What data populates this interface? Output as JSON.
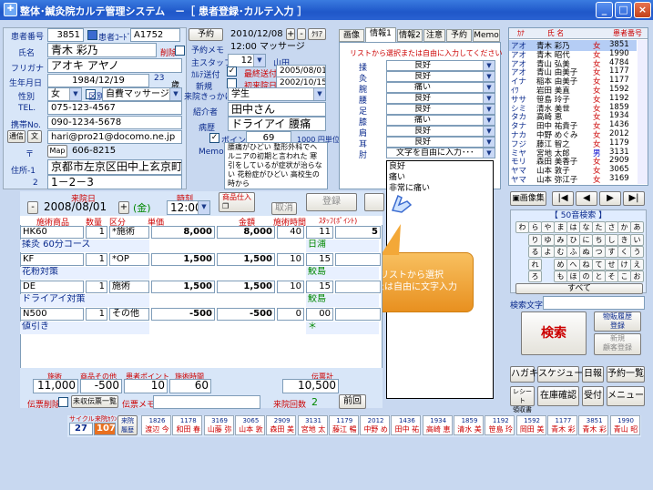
{
  "window": {
    "title": "整体･鍼灸院カルテ管理システム　－［ 患者登録･カルテ入力 ］"
  },
  "patient": {
    "id_label": "患者番号",
    "id": "3851",
    "code_label": "患者ｺｰﾄﾞ",
    "code": "A1752",
    "delete_label": "削除",
    "name_label": "氏名",
    "name": "青木 彩乃",
    "kana_label": "フリガナ",
    "kana": "アオキ アヤノ",
    "birth_label": "生年月日",
    "birth": "1984/12/19",
    "age": "23",
    "age_unit": "歳",
    "sex_label": "性別",
    "sex": "女",
    "kubun_label": "区別",
    "kubun": "自費マッサージ",
    "tel_label": "TEL.",
    "tel": "075-123-4567",
    "mobile_label": "携帯No.",
    "mobile": "090-1234-5678",
    "mail_btn": "通信",
    "mail_btn2": "文",
    "email": "hari@pro21@docomo.ne.jp",
    "zip_label": "〒",
    "map_btn": "Map",
    "zip": "606-8215",
    "addr1_label": "住所-1",
    "addr1": "京都市左京区田中上玄京町",
    "addr2_label": "2",
    "addr2": "1－2－3"
  },
  "reserve": {
    "btn": "予約",
    "date": "2010/12/08",
    "plus": "+",
    "minus": "-",
    "clear": "ｸﾘｱ",
    "memo_label": "予約メモ",
    "memo": "12:00 マッサージ",
    "staff_label": "主スタッフ",
    "staff_no": "12",
    "staff": "山田",
    "visit_label": "ｶﾙﾃ送付",
    "last_label": "最終送付",
    "last_date": "2005/08/01",
    "new_label": "新規",
    "first_label": "初来院日",
    "first_date": "2002/10/15",
    "trigger_label": "来院きっかけ",
    "trigger": "学生",
    "intro_label": "紹介者",
    "intro": "田中さん",
    "disease_label": "病歴",
    "disease": "ドライアイ 腰痛",
    "point_label": "ポイント",
    "points": "69",
    "unit_price": "1000 円単位",
    "memo2_label": "Memo",
    "memo2": "腰痛がひどい 整形外科でヘルニアの初期と言われた 寒引をしているが症状が治らない 花粉症がひどい 高校生の時から"
  },
  "tabs": [
    {
      "label": "画像",
      "active": false
    },
    {
      "label": "情報1",
      "active": true
    },
    {
      "label": "情報2",
      "active": false
    },
    {
      "label": "注意",
      "active": false
    },
    {
      "label": "予約",
      "active": false
    },
    {
      "label": "Memo",
      "active": false
    }
  ],
  "info1": {
    "hint": "リストから選択または自由に入力してください",
    "rows": [
      {
        "label": "揉",
        "value": "良好"
      },
      {
        "label": "灸",
        "value": "良好"
      },
      {
        "label": "腕",
        "value": "痛い"
      },
      {
        "label": "腰",
        "value": "良好"
      },
      {
        "label": "足",
        "value": "良好"
      },
      {
        "label": "膝",
        "value": "痛い"
      },
      {
        "label": "肩",
        "value": "良好"
      },
      {
        "label": "耳",
        "value": "良好"
      },
      {
        "label": "肘",
        "value": "文字を自由に入力･･･"
      }
    ],
    "dropdown_options": [
      "良好",
      "痛い",
      "非常に痛い"
    ]
  },
  "callout": {
    "text": "リストから選択\nまたは自由に文字入力"
  },
  "patient_list": {
    "headers": [
      "ｶﾅ",
      "氏 名",
      "",
      "患者番号"
    ],
    "rows": [
      {
        "kana": "アオ",
        "name": "青木 彩乃",
        "sex": "女",
        "no": "3851"
      },
      {
        "kana": "アオ",
        "name": "青木 昭代",
        "sex": "女",
        "no": "1990"
      },
      {
        "kana": "アオ",
        "name": "青山 弘美",
        "sex": "女",
        "no": "4784"
      },
      {
        "kana": "アオ",
        "name": "青山 由美子",
        "sex": "女",
        "no": "1177"
      },
      {
        "kana": "イナ",
        "name": "稲本 由美子",
        "sex": "女",
        "no": "1177"
      },
      {
        "kana": "ｲﾜ",
        "name": "岩田 美直",
        "sex": "女",
        "no": "1592"
      },
      {
        "kana": "ササ",
        "name": "笹島 玲子",
        "sex": "女",
        "no": "1192"
      },
      {
        "kana": "シミ",
        "name": "清水 美世",
        "sex": "女",
        "no": "1859"
      },
      {
        "kana": "タカ",
        "name": "高崎 恵",
        "sex": "女",
        "no": "1934"
      },
      {
        "kana": "タナ",
        "name": "田中 祐貴子",
        "sex": "女",
        "no": "1436"
      },
      {
        "kana": "ナカ",
        "name": "中野 めぐみ",
        "sex": "女",
        "no": "2012"
      },
      {
        "kana": "フジ",
        "name": "藤江 智之",
        "sex": "女",
        "no": "1179"
      },
      {
        "kana": "ミヤ",
        "name": "宮地 太郎",
        "sex": "男",
        "no": "3131"
      },
      {
        "kana": "モリ",
        "name": "森田 美香子",
        "sex": "女",
        "no": "2909"
      },
      {
        "kana": "ヤマ",
        "name": "山本 敦子",
        "sex": "女",
        "no": "3065"
      },
      {
        "kana": "ヤマ",
        "name": "山本 弥江子",
        "sex": "女",
        "no": "3169"
      }
    ]
  },
  "nav": {
    "image_btn": "画像集"
  },
  "kana_search": {
    "title": "【 50音検索 】",
    "rows": [
      [
        "わ",
        "ら",
        "や",
        "ま",
        "は",
        "な",
        "た",
        "さ",
        "か",
        "あ"
      ],
      [
        "",
        "り",
        "ゆ",
        "み",
        "ひ",
        "に",
        "ち",
        "し",
        "き",
        "い"
      ],
      [
        "",
        "る",
        "よ",
        "む",
        "ふ",
        "ぬ",
        "つ",
        "す",
        "く",
        "う"
      ],
      [
        "",
        "れ",
        "",
        "め",
        "へ",
        "ね",
        "て",
        "せ",
        "け",
        "え"
      ],
      [
        "",
        "ろ",
        "",
        "も",
        "ほ",
        "の",
        "と",
        "そ",
        "こ",
        "お"
      ]
    ],
    "all": "すべて",
    "search_label": "検索文字",
    "search_btn": "検索",
    "detail_btn": "物販履歴\n登録",
    "new_btn": "新規\n顧客登録"
  },
  "bottom_buttons": [
    [
      "ハガキ",
      "スケジュール",
      "日報",
      "予約一覧"
    ],
    [
      "レシート\n領収書",
      "在庫確認",
      "受付",
      "メニュー"
    ]
  ],
  "visit": {
    "date_label": "来院日",
    "date": "2008/08/01",
    "plus": "+",
    "minus": "-",
    "kin": "金",
    "time_label": "時刻",
    "time": "12:00",
    "product_btn": "商品仕入",
    "cancel_btn": "取消",
    "register_btn": "登録"
  },
  "grid": {
    "headers": [
      "施術商品",
      "数量",
      "区分",
      "単価",
      "金額",
      "施術時間",
      "ｽﾀｯﾌ(ﾎﾟｲﾝﾄ)"
    ],
    "rows": [
      {
        "item": "HK60",
        "qty": "1",
        "kubun": "*施術",
        "price": "8,000",
        "amount": "8,000",
        "time": "40",
        "staff": "11",
        "pt": "5"
      },
      {
        "item": "揉灸 60分コース",
        "qty": "",
        "kubun": "",
        "price": "",
        "amount": "",
        "time": "",
        "staff": "日浦",
        "pt": ""
      },
      {
        "item": "KF",
        "qty": "1",
        "kubun": "*OP",
        "price": "1,500",
        "amount": "1,500",
        "time": "10",
        "staff": "15",
        "pt": ""
      },
      {
        "item": "花粉対策",
        "qty": "",
        "kubun": "",
        "price": "",
        "amount": "",
        "time": "",
        "staff": "鮫島",
        "pt": ""
      },
      {
        "item": "DE",
        "qty": "1",
        "kubun": "施術",
        "price": "1,500",
        "amount": "1,500",
        "time": "10",
        "staff": "15",
        "pt": ""
      },
      {
        "item": "ドライアイ対策",
        "qty": "",
        "kubun": "",
        "price": "",
        "amount": "",
        "time": "",
        "staff": "鮫島",
        "pt": ""
      },
      {
        "item": "N500",
        "qty": "1",
        "kubun": "その他",
        "price": "-500",
        "amount": "-500",
        "time": "0",
        "staff": "00",
        "pt": ""
      },
      {
        "item": "値引き",
        "qty": "",
        "kubun": "",
        "price": "",
        "amount": "",
        "time": "",
        "staff": "＊",
        "pt": ""
      }
    ]
  },
  "totals": {
    "labels": [
      "施術",
      "商品その他",
      "患者ポイント",
      "施術時間"
    ],
    "values": [
      "11,000",
      "-500",
      "10",
      "60"
    ],
    "slip_label": "伝票計",
    "slip_total": "10,500",
    "del_label": "伝票削除",
    "not_received": "未収伝票一覧",
    "memo_label": "伝票メモ",
    "visits_label": "来院回数",
    "visits": "2",
    "prev_btn": "前回"
  },
  "footer": {
    "cycle_label": "サイクル",
    "cycle_no_label": "来院ｶｳﾝﾄ",
    "cycle": "27",
    "count": "107",
    "history_btn": "来院\n履歴",
    "recent": [
      {
        "no": "1826",
        "name": "渡辺 今"
      },
      {
        "no": "1178",
        "name": "和田 春"
      },
      {
        "no": "3169",
        "name": "山藤 弥"
      },
      {
        "no": "3065",
        "name": "山本 敦"
      },
      {
        "no": "2909",
        "name": "森田 美"
      },
      {
        "no": "3131",
        "name": "宮地 太"
      },
      {
        "no": "1179",
        "name": "藤江 暢"
      },
      {
        "no": "2012",
        "name": "中野 め"
      },
      {
        "no": "1436",
        "name": "田中 祐"
      },
      {
        "no": "1934",
        "name": "高崎 恵"
      },
      {
        "no": "1859",
        "name": "清水 美"
      },
      {
        "no": "1192",
        "name": "笹島 玲"
      },
      {
        "no": "1592",
        "name": "岡田 美"
      },
      {
        "no": "1177",
        "name": "青木 彩"
      },
      {
        "no": "3851",
        "name": "青木 彩"
      },
      {
        "no": "1990",
        "name": "青山 昭"
      }
    ]
  },
  "colors": {
    "title_bar": "#1f57c9",
    "label": "#0a2a8c",
    "accent_red": "#cc0000",
    "callout": "#f0a030"
  }
}
